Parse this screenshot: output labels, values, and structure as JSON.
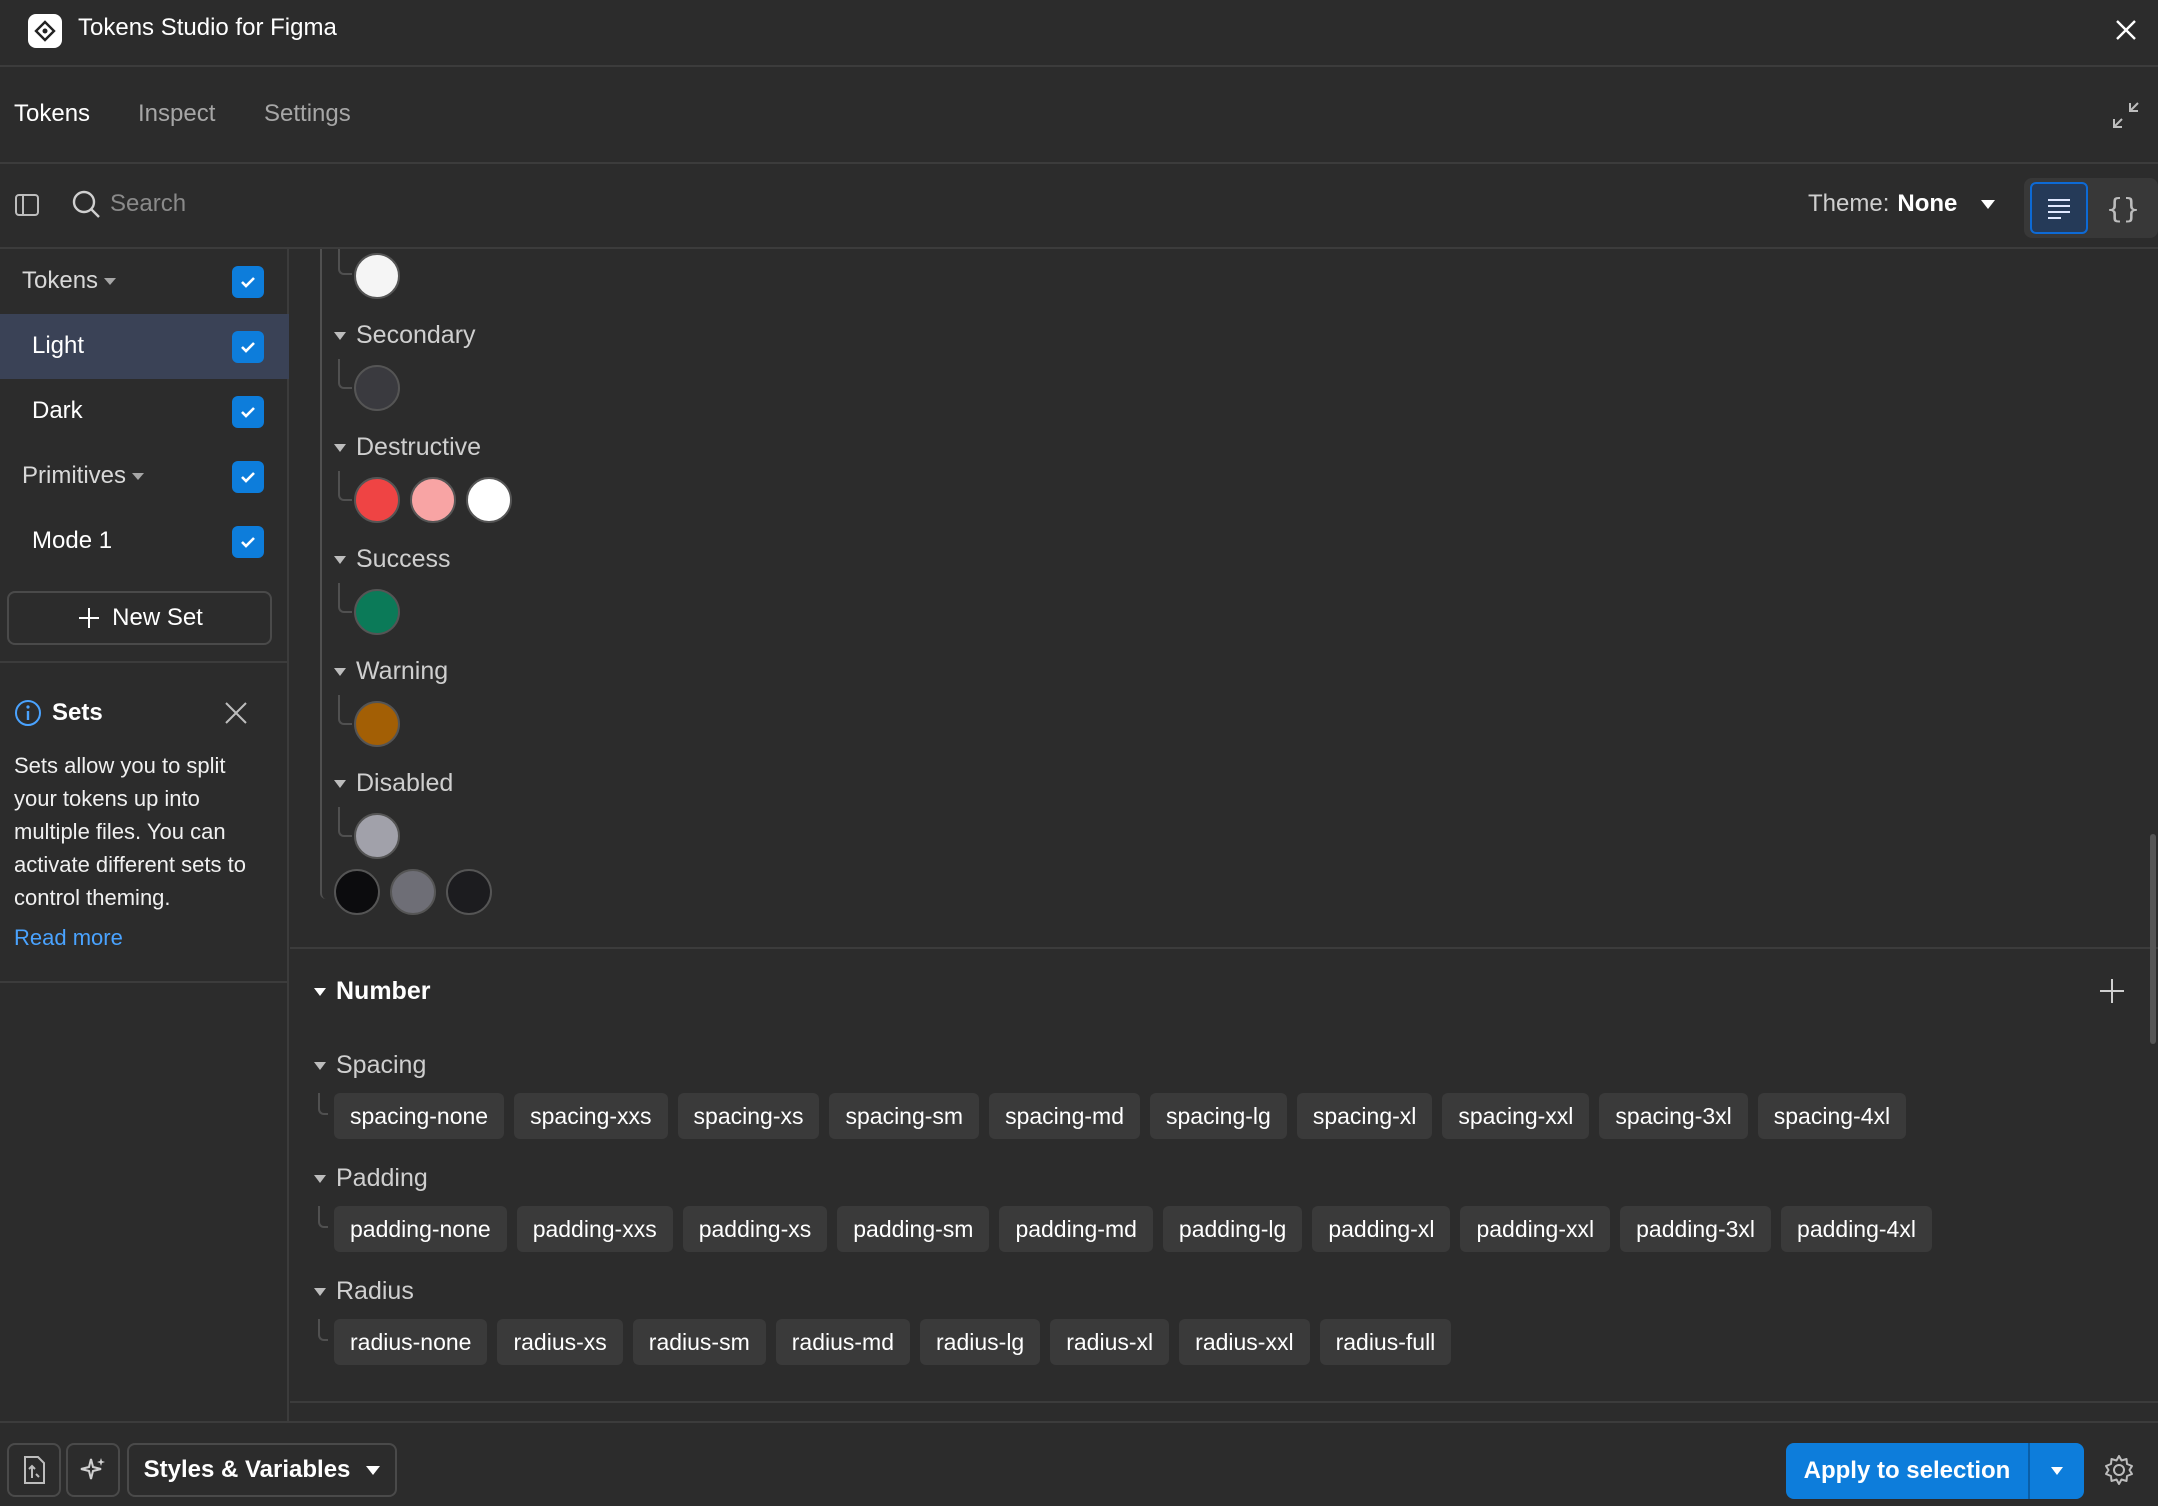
{
  "app": {
    "title": "Tokens Studio for Figma"
  },
  "tabs": [
    {
      "label": "Tokens",
      "active": true
    },
    {
      "label": "Inspect",
      "active": false
    },
    {
      "label": "Settings",
      "active": false
    }
  ],
  "toolbar": {
    "search_placeholder": "Search",
    "theme_label": "Theme:",
    "theme_value": "None"
  },
  "sidebar": {
    "sets": [
      {
        "label": "Tokens",
        "type": "group",
        "checked": true
      },
      {
        "label": "Light",
        "type": "set",
        "checked": true,
        "active": true
      },
      {
        "label": "Dark",
        "type": "set",
        "checked": true
      },
      {
        "label": "Primitives",
        "type": "group",
        "checked": true
      },
      {
        "label": "Mode 1",
        "type": "set",
        "checked": true
      }
    ],
    "new_set_label": "New Set",
    "info": {
      "title": "Sets",
      "text": "Sets allow you to split your tokens up into multiple files. You can activate different sets to control theming.",
      "link": "Read more"
    }
  },
  "color_groups": [
    {
      "label": "Secondary",
      "swatches": [
        "#3a3a3f"
      ]
    },
    {
      "label": "Destructive",
      "swatches": [
        "#ef4444",
        "#f8a4a4",
        "#ffffff"
      ]
    },
    {
      "label": "Success",
      "swatches": [
        "#0b7a58"
      ]
    },
    {
      "label": "Warning",
      "swatches": [
        "#a35f05"
      ]
    },
    {
      "label": "Disabled",
      "swatches": [
        "#a1a1aa"
      ]
    }
  ],
  "color_top_swatch": "#f5f5f5",
  "color_bottom_swatches": [
    "#0c0c0e",
    "#6e6e76",
    "#1c1c1f"
  ],
  "number": {
    "label": "Number",
    "groups": [
      {
        "label": "Spacing",
        "tokens": [
          "spacing-none",
          "spacing-xxs",
          "spacing-xs",
          "spacing-sm",
          "spacing-md",
          "spacing-lg",
          "spacing-xl",
          "spacing-xxl",
          "spacing-3xl",
          "spacing-4xl"
        ]
      },
      {
        "label": "Padding",
        "tokens": [
          "padding-none",
          "padding-xxs",
          "padding-xs",
          "padding-sm",
          "padding-md",
          "padding-lg",
          "padding-xl",
          "padding-xxl",
          "padding-3xl",
          "padding-4xl"
        ]
      },
      {
        "label": "Radius",
        "tokens": [
          "radius-none",
          "radius-xs",
          "radius-sm",
          "radius-md",
          "radius-lg",
          "radius-xl",
          "radius-xxl",
          "radius-full"
        ]
      }
    ]
  },
  "footer": {
    "styles_label": "Styles & Variables",
    "apply_label": "Apply to selection"
  },
  "colors": {
    "accent": "#0d7ddb",
    "link": "#4aa3ff",
    "active_row": "#3a4256"
  }
}
